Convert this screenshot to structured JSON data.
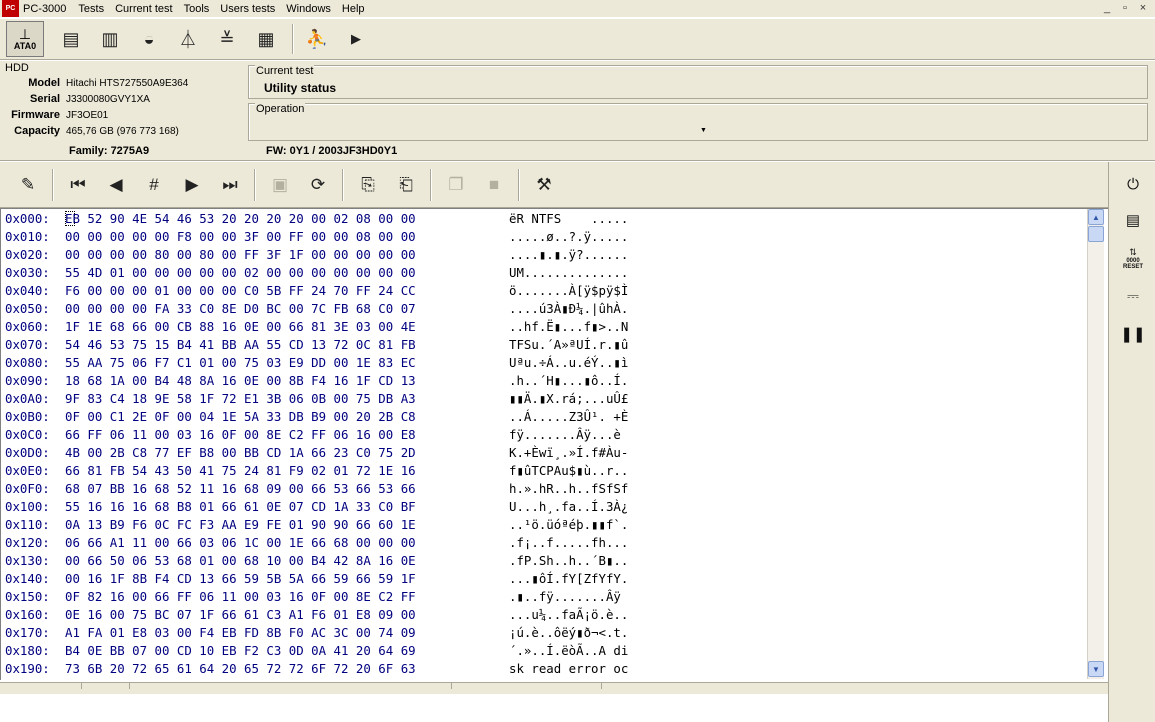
{
  "app": {
    "logo_text": "PC",
    "title": "PC-3000",
    "menu": [
      "Tests",
      "Current test",
      "Tools",
      "Users tests",
      "Windows",
      "Help"
    ],
    "window_controls": [
      "_",
      "▫",
      "×"
    ]
  },
  "toolbar1": {
    "ata_label": "ATA0",
    "icons": [
      "drive-info-icon",
      "chip-icon",
      "disk-icon",
      "antenna-icon",
      "stack-icon",
      "grid-icon",
      "runner-icon",
      "play-icon"
    ]
  },
  "hdd": {
    "title": "HDD",
    "rows": [
      {
        "label": "Model",
        "value": "Hitachi HTS727550A9E364"
      },
      {
        "label": "Serial",
        "value": "J3300080GVY1XA"
      },
      {
        "label": "Firmware",
        "value": "JF3OE01"
      },
      {
        "label": "Capacity",
        "value": "465,76 GB (976 773 168)"
      }
    ]
  },
  "current_test": {
    "title": "Current test",
    "value": "Utility status"
  },
  "operation": {
    "title": "Operation",
    "value": ""
  },
  "family": {
    "text": "Family: 7275A9",
    "fw": "FW:  0Y1 / 2003JF3HD0Y1"
  },
  "hex": {
    "rows": [
      {
        "offset": "0x000:",
        "bytes": "EB 52 90 4E 54 46 53 20 20 20 20 00 02 08 00 00",
        "ascii": "ëR NTFS    ....."
      },
      {
        "offset": "0x010:",
        "bytes": "00 00 00 00 00 F8 00 00 3F 00 FF 00 00 08 00 00",
        "ascii": ".....ø..?.ÿ....."
      },
      {
        "offset": "0x020:",
        "bytes": "00 00 00 00 80 00 80 00 FF 3F 1F 00 00 00 00 00",
        "ascii": "....▮.▮.ÿ?......"
      },
      {
        "offset": "0x030:",
        "bytes": "55 4D 01 00 00 00 00 00 02 00 00 00 00 00 00 00",
        "ascii": "UM.............."
      },
      {
        "offset": "0x040:",
        "bytes": "F6 00 00 00 01 00 00 00 C0 5B FF 24 70 FF 24 CC",
        "ascii": "ö.......À[ÿ$pÿ$Ì"
      },
      {
        "offset": "0x050:",
        "bytes": "00 00 00 00 FA 33 C0 8E D0 BC 00 7C FB 68 C0 07",
        "ascii": "....ú3À▮Ð¼.|ûhÀ."
      },
      {
        "offset": "0x060:",
        "bytes": "1F 1E 68 66 00 CB 88 16 0E 00 66 81 3E 03 00 4E",
        "ascii": "..hf.Ë▮...f▮>..N"
      },
      {
        "offset": "0x070:",
        "bytes": "54 46 53 75 15 B4 41 BB AA 55 CD 13 72 0C 81 FB",
        "ascii": "TFSu.´A»ªUÍ.r.▮û"
      },
      {
        "offset": "0x080:",
        "bytes": "55 AA 75 06 F7 C1 01 00 75 03 E9 DD 00 1E 83 EC",
        "ascii": "Uªu.÷Á..u.éÝ..▮ì"
      },
      {
        "offset": "0x090:",
        "bytes": "18 68 1A 00 B4 48 8A 16 0E 00 8B F4 16 1F CD 13",
        "ascii": ".h..´H▮...▮ô..Í."
      },
      {
        "offset": "0x0A0:",
        "bytes": "9F 83 C4 18 9E 58 1F 72 E1 3B 06 0B 00 75 DB A3",
        "ascii": "▮▮Ä.▮X.rá;...uÛ£"
      },
      {
        "offset": "0x0B0:",
        "bytes": "0F 00 C1 2E 0F 00 04 1E 5A 33 DB B9 00 20 2B C8",
        "ascii": "..Á.....Z3Û¹. +È"
      },
      {
        "offset": "0x0C0:",
        "bytes": "66 FF 06 11 00 03 16 0F 00 8E C2 FF 06 16 00 E8",
        "ascii": "fÿ.......Âÿ...è"
      },
      {
        "offset": "0x0D0:",
        "bytes": "4B 00 2B C8 77 EF B8 00 BB CD 1A 66 23 C0 75 2D",
        "ascii": "K.+Èwï¸.»Í.f#Àu-"
      },
      {
        "offset": "0x0E0:",
        "bytes": "66 81 FB 54 43 50 41 75 24 81 F9 02 01 72 1E 16",
        "ascii": "f▮ûTCPAu$▮ù..r.."
      },
      {
        "offset": "0x0F0:",
        "bytes": "68 07 BB 16 68 52 11 16 68 09 00 66 53 66 53 66",
        "ascii": "h.».hR..h..fSfSf"
      },
      {
        "offset": "0x100:",
        "bytes": "55 16 16 16 68 B8 01 66 61 0E 07 CD 1A 33 C0 BF",
        "ascii": "U...h¸.fa..Í.3À¿"
      },
      {
        "offset": "0x110:",
        "bytes": "0A 13 B9 F6 0C FC F3 AA E9 FE 01 90 90 66 60 1E",
        "ascii": "..¹ö.üóªéþ.▮▮f`."
      },
      {
        "offset": "0x120:",
        "bytes": "06 66 A1 11 00 66 03 06 1C 00 1E 66 68 00 00 00",
        "ascii": ".f¡..f.....fh..."
      },
      {
        "offset": "0x130:",
        "bytes": "00 66 50 06 53 68 01 00 68 10 00 B4 42 8A 16 0E",
        "ascii": ".fP.Sh..h..´B▮.."
      },
      {
        "offset": "0x140:",
        "bytes": "00 16 1F 8B F4 CD 13 66 59 5B 5A 66 59 66 59 1F",
        "ascii": "...▮ôÍ.fY[ZfYfY."
      },
      {
        "offset": "0x150:",
        "bytes": "0F 82 16 00 66 FF 06 11 00 03 16 0F 00 8E C2 FF",
        "ascii": ".▮..fÿ.......Âÿ"
      },
      {
        "offset": "0x160:",
        "bytes": "0E 16 00 75 BC 07 1F 66 61 C3 A1 F6 01 E8 09 00",
        "ascii": "...u¼..faÃ¡ö.è.."
      },
      {
        "offset": "0x170:",
        "bytes": "A1 FA 01 E8 03 00 F4 EB FD 8B F0 AC 3C 00 74 09",
        "ascii": "¡ú.è..ôëý▮ð¬<.t."
      },
      {
        "offset": "0x180:",
        "bytes": "B4 0E BB 07 00 CD 10 EB F2 C3 0D 0A 41 20 64 69",
        "ascii": "´.»..Í.ëòÃ..A di"
      },
      {
        "offset": "0x190:",
        "bytes": "73 6B 20 72 65 61 64 20 65 72 72 6F 72 20 6F 63",
        "ascii": "sk read error oc"
      }
    ]
  },
  "side": {
    "reset_label": "RESET",
    "counter_label": "0000"
  },
  "colors": {
    "chrome": "#ece9d8",
    "hex_blue": "#000080",
    "logo_red": "#c00000"
  }
}
